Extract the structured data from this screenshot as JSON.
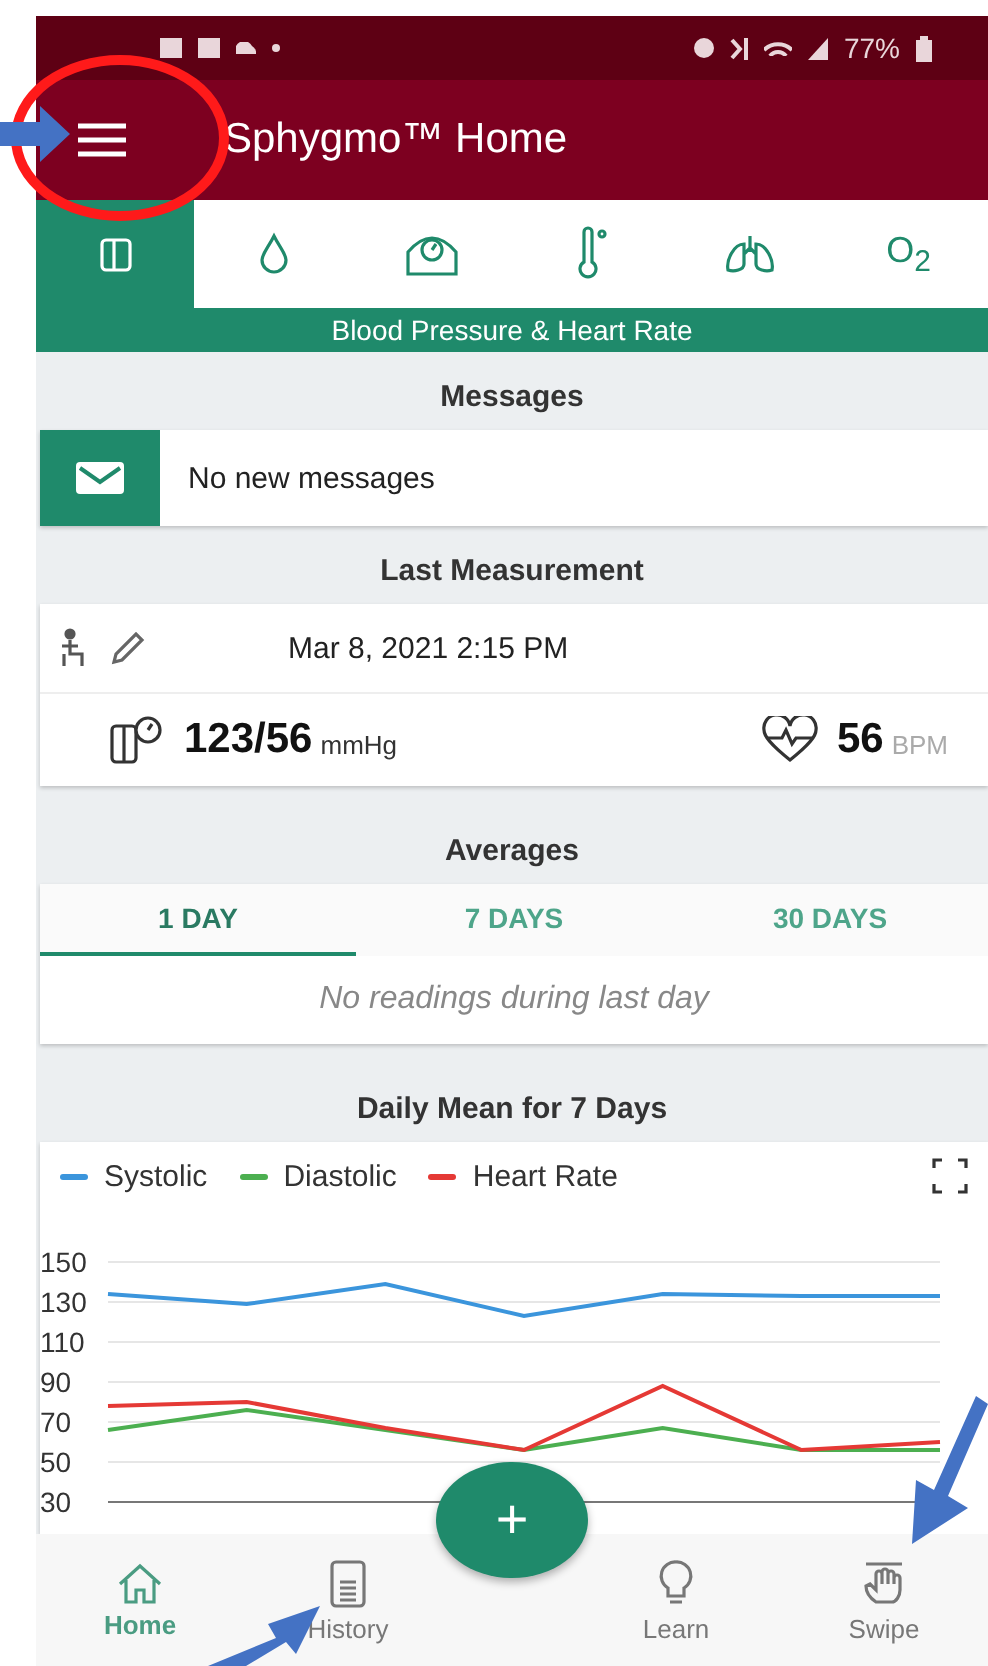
{
  "status_bar": {
    "battery": "77%"
  },
  "app_bar": {
    "title": "Sphygmo™ Home"
  },
  "categories": {
    "items": [
      {
        "kind": "blood-pressure",
        "selected": true
      },
      {
        "kind": "drop",
        "selected": false
      },
      {
        "kind": "scale",
        "selected": false
      },
      {
        "kind": "thermometer",
        "selected": false
      },
      {
        "kind": "lungs",
        "selected": false
      },
      {
        "kind": "oxygen",
        "label": "O$_{2}$",
        "selected": false
      }
    ],
    "caption": "Blood Pressure & Heart Rate"
  },
  "messages": {
    "heading": "Messages",
    "text": "No new messages"
  },
  "last_measurement": {
    "heading": "Last Measurement",
    "date": "Mar 8, 2021 2:15 PM",
    "pressure": "123/56",
    "pressure_unit": "mmHg",
    "pulse": "56",
    "pulse_unit": "BPM"
  },
  "averages": {
    "heading": "Averages",
    "tabs": [
      {
        "label": "1 DAY",
        "selected": true
      },
      {
        "label": "7 DAYS",
        "selected": false
      },
      {
        "label": "30 DAYS",
        "selected": false
      }
    ],
    "empty_text": "No readings during last day"
  },
  "daily_mean": {
    "heading": "Daily Mean for 7 Days",
    "chart_data": {
      "type": "line",
      "grid": true,
      "ylim": [
        30,
        150
      ],
      "yticks": [
        30,
        50,
        70,
        90,
        110,
        130,
        150
      ],
      "series": [
        {
          "name": "Systolic",
          "color": "#3b95dc",
          "values": [
            134,
            129,
            139,
            123,
            134,
            133,
            133
          ]
        },
        {
          "name": "Diastolic",
          "color": "#4caf50",
          "values": [
            66,
            76,
            66,
            56,
            67,
            56,
            56
          ]
        },
        {
          "name": "Heart Rate",
          "color": "#e53935",
          "values": [
            78,
            80,
            67,
            56,
            88,
            56,
            60
          ]
        }
      ]
    }
  },
  "fab": {
    "label": "+"
  },
  "bottom_nav": [
    {
      "kind": "home",
      "label": "Home",
      "selected": true
    },
    {
      "kind": "history",
      "label": "History",
      "selected": false
    },
    {
      "kind": "learn",
      "label": "Learn",
      "selected": false
    },
    {
      "kind": "swipe",
      "label": "Swipe",
      "selected": false
    }
  ]
}
